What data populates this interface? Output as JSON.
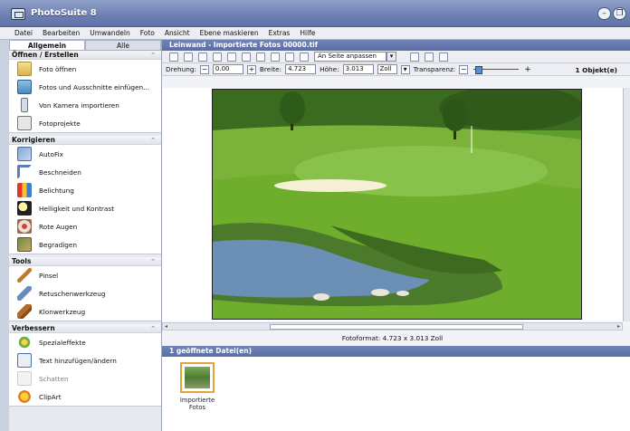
{
  "window": {
    "title": "PhotoSuite 8"
  },
  "menu": [
    "Datei",
    "Bearbeiten",
    "Umwandeln",
    "Foto",
    "Ansicht",
    "Ebene maskieren",
    "Extras",
    "Hilfe"
  ],
  "left": {
    "tabs": [
      "Allgemein",
      "Alle"
    ],
    "sections": [
      {
        "title": "Öffnen / Erstellen",
        "items": [
          {
            "label": "Foto öffnen",
            "icon": "folder-icon"
          },
          {
            "label": "Fotos und Ausschnitte einfügen...",
            "icon": "add-photos-icon"
          },
          {
            "label": "Von Kamera importieren",
            "icon": "camera-icon"
          },
          {
            "label": "Fotoprojekte",
            "icon": "project-icon"
          }
        ]
      },
      {
        "title": "Korrigieren",
        "items": [
          {
            "label": "AutoFix",
            "icon": "autofix-icon"
          },
          {
            "label": "Beschneiden",
            "icon": "crop-icon"
          },
          {
            "label": "Belichtung",
            "icon": "exposure-icon"
          },
          {
            "label": "Helligkeit und Kontrast",
            "icon": "brightness-icon"
          },
          {
            "label": "Rote Augen",
            "icon": "red-eye-icon"
          },
          {
            "label": "Begradigen",
            "icon": "straighten-icon"
          }
        ]
      },
      {
        "title": "Tools",
        "items": [
          {
            "label": "Pinsel",
            "icon": "brush-icon"
          },
          {
            "label": "Retuschenwerkzeug",
            "icon": "retouch-icon"
          },
          {
            "label": "Klonwerkzeug",
            "icon": "clone-icon"
          }
        ]
      },
      {
        "title": "Verbessern",
        "items": [
          {
            "label": "Spezialeffekte",
            "icon": "effects-icon"
          },
          {
            "label": "Text hinzufügen/ändern",
            "icon": "text-icon"
          },
          {
            "label": "Schatten",
            "icon": "shadow-icon",
            "disabled": true
          },
          {
            "label": "ClipArt",
            "icon": "clipart-icon"
          }
        ]
      }
    ]
  },
  "document": {
    "title": "Leinwand - Importierte Fotos 00000.tif",
    "fit_select": "An Seite anpassen",
    "rotation_label": "Drehung:",
    "rotation_value": "0.00",
    "width_label": "Breite:",
    "width_value": "4.723",
    "height_label": "Höhe:",
    "height_value": "3.013",
    "unit": "Zoll",
    "transparency_label": "Transparenz:",
    "object_count": "1 Objekt(e)",
    "format_text": "Fotoformat: 4.723 x 3.013 Zoll"
  },
  "open_files": {
    "header": "1 geöffnete Datei(en)",
    "files": [
      {
        "caption": "Importierte Fotos"
      }
    ]
  }
}
